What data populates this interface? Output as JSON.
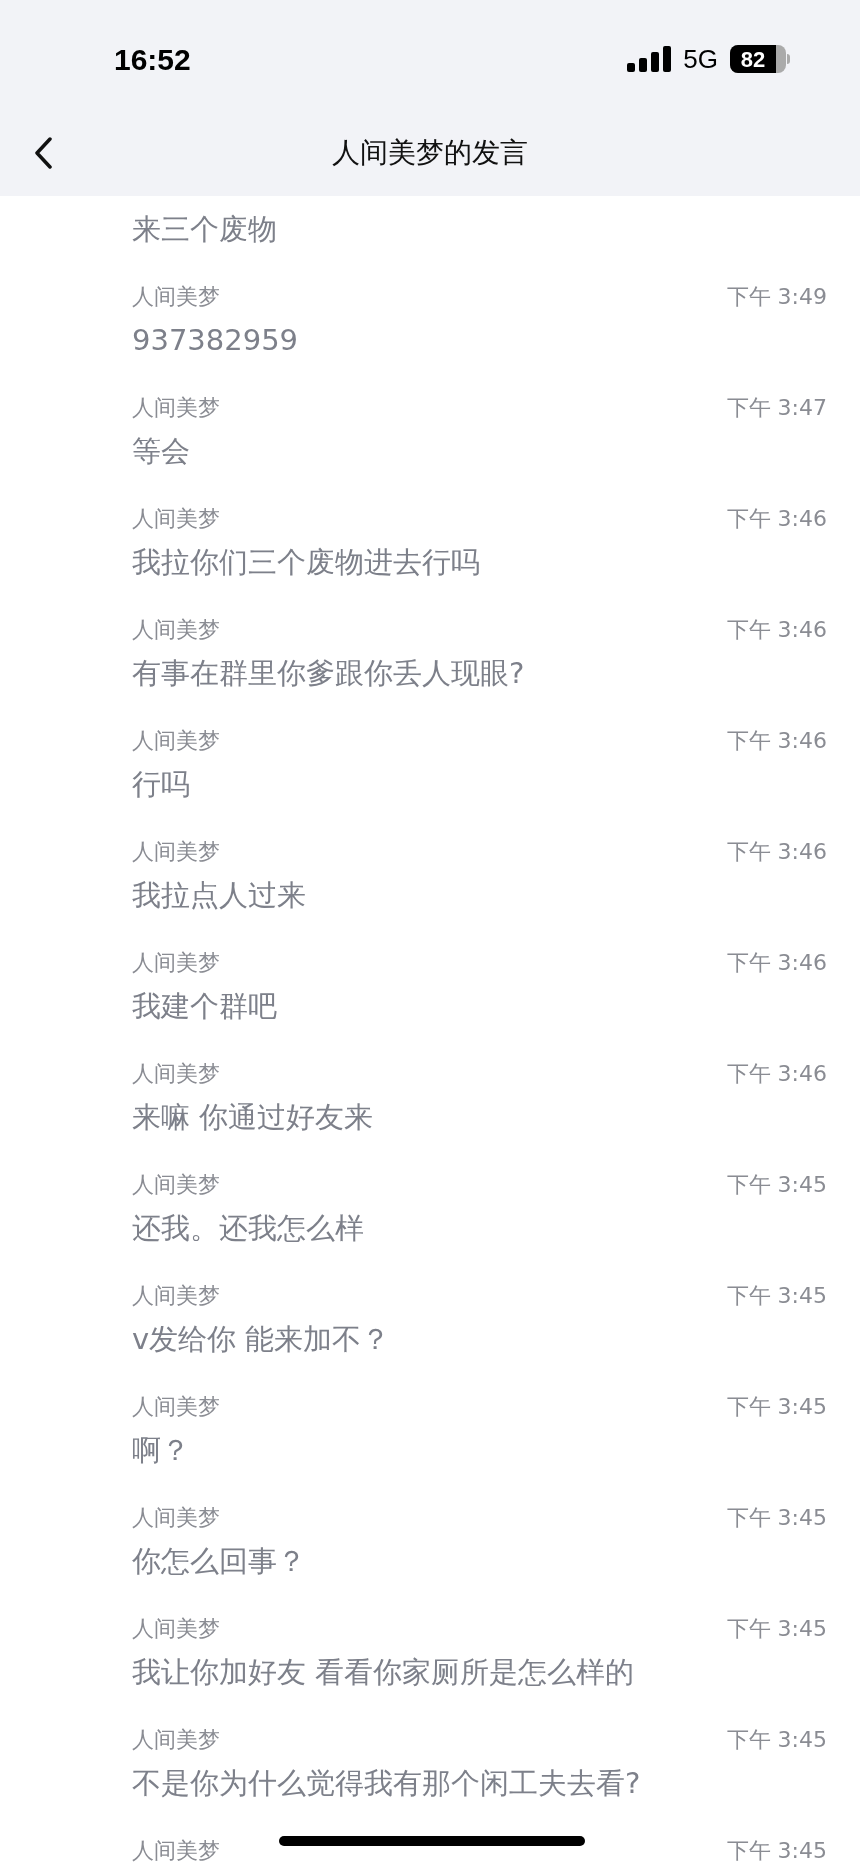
{
  "status_bar": {
    "time": "16:52",
    "network": "5G",
    "battery": "82"
  },
  "header": {
    "title": "人间美梦的发言"
  },
  "messages": [
    {
      "text": "来三个废物"
    },
    {
      "name": "人间美梦",
      "time": "下午 3:49",
      "text": "937382959"
    },
    {
      "name": "人间美梦",
      "time": "下午 3:47",
      "text": "等会"
    },
    {
      "name": "人间美梦",
      "time": "下午 3:46",
      "text": "我拉你们三个废物进去行吗"
    },
    {
      "name": "人间美梦",
      "time": "下午 3:46",
      "text": "有事在群里你爹跟你丢人现眼?"
    },
    {
      "name": "人间美梦",
      "time": "下午 3:46",
      "text": "行吗"
    },
    {
      "name": "人间美梦",
      "time": "下午 3:46",
      "text": "我拉点人过来"
    },
    {
      "name": "人间美梦",
      "time": "下午 3:46",
      "text": "我建个群吧"
    },
    {
      "name": "人间美梦",
      "time": "下午 3:46",
      "text": "来嘛 你通过好友来"
    },
    {
      "name": "人间美梦",
      "time": "下午 3:45",
      "text": "还我。还我怎么样"
    },
    {
      "name": "人间美梦",
      "time": "下午 3:45",
      "text": "v发给你 能来加不？"
    },
    {
      "name": "人间美梦",
      "time": "下午 3:45",
      "text": "啊？"
    },
    {
      "name": "人间美梦",
      "time": "下午 3:45",
      "text": "你怎么回事？"
    },
    {
      "name": "人间美梦",
      "time": "下午 3:45",
      "text": "我让你加好友 看看你家厕所是怎么样的"
    },
    {
      "name": "人间美梦",
      "time": "下午 3:45",
      "text": "不是你为什么觉得我有那个闲工夫去看?"
    },
    {
      "name": "人间美梦",
      "time": "下午 3:45"
    }
  ]
}
